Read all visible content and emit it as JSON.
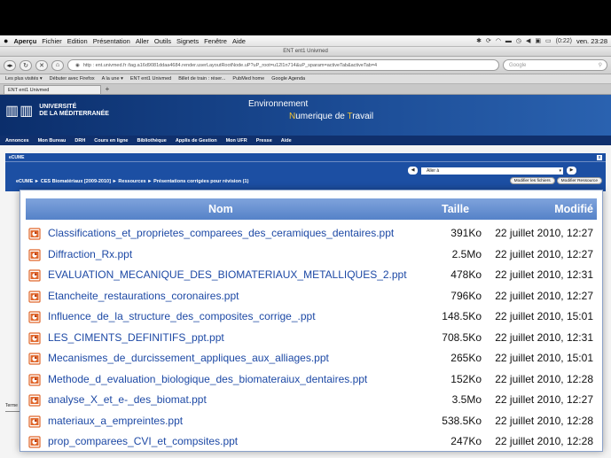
{
  "menubar": {
    "app": "Aperçu",
    "items": [
      "Fichier",
      "Edition",
      "Présentation",
      "Aller",
      "Outils",
      "Signets",
      "Fenêtre",
      "Aide"
    ],
    "battery": "(0:22)",
    "clock": "ven. 23:28"
  },
  "browser": {
    "window_title": "ENT ent1 Univmed",
    "url": "http : ent.univmed.fr /tag.a16d9081ddaa4684.render.userLayoutRootNode.uP?uP_root=u12l1n714&uP_sparam=activeTab&activeTab=4",
    "search_placeholder": "Google",
    "bookmarks": [
      "Les plus visités ▾",
      "Débuter avec Firefox",
      "A la une ▾",
      "ENT ent1 Univmed",
      "Billet de train : réser...",
      "PubMed home",
      "Google Agenda"
    ],
    "tab_label": "ENT ent1 Univmed",
    "newtab_label": "+"
  },
  "site": {
    "university_line1": "UNIVERSITÉ",
    "university_line2": "DE LA MÉDITERRANÉE",
    "env_line1_prefix": "Environnement",
    "env_line2_a": "N",
    "env_line2_b": "umerique de ",
    "env_line2_c": "T",
    "env_line2_d": "ravail",
    "nav": [
      "Annonces",
      "Mon Bureau",
      "DRH",
      "Cours en ligne",
      "Bibliothèque",
      "Applis de Gestion",
      "Mon UFR",
      "Presse",
      "Aide"
    ]
  },
  "ecume": {
    "title": "eCUME",
    "close": "x",
    "goto_label": "Aller à",
    "breadcrumb": "eCUME  ►  CES Biomatériaux [2009-2010]  ►  Ressources  ►  Présentations corrigées pour révision (1)",
    "btn_files": "Modifier les fichiers",
    "btn_resource": "Modifier Ressource",
    "footer_link": "Terme"
  },
  "files": {
    "col_name": "Nom",
    "col_size": "Taille",
    "col_modified": "Modifié",
    "rows": [
      {
        "name": "Classifications_et_proprietes_comparees_des_ceramiques_dentaires.ppt",
        "size": "391Ko",
        "date": "22 juillet 2010, 12:27"
      },
      {
        "name": "Diffraction_Rx.ppt",
        "size": "2.5Mo",
        "date": "22 juillet 2010, 12:27"
      },
      {
        "name": "EVALUATION_MECANIQUE_DES_BIOMATERIAUX_METALLIQUES_2.ppt",
        "size": "478Ko",
        "date": "22 juillet 2010, 12:31"
      },
      {
        "name": "Etancheite_restaurations_coronaires.ppt",
        "size": "796Ko",
        "date": "22 juillet 2010, 12:27"
      },
      {
        "name": "Influence_de_la_structure_des_composites_corrige_.ppt",
        "size": "148.5Ko",
        "date": "22 juillet 2010, 15:01"
      },
      {
        "name": "LES_CIMENTS_DEFINITIFS_ppt.ppt",
        "size": "708.5Ko",
        "date": "22 juillet 2010, 12:31"
      },
      {
        "name": "Mecanismes_de_durcissement_appliques_aux_alliages.ppt",
        "size": "265Ko",
        "date": "22 juillet 2010, 15:01"
      },
      {
        "name": "Methode_d_evaluation_biologique_des_biomateraiux_dentaires.ppt",
        "size": "152Ko",
        "date": "22 juillet 2010, 12:28"
      },
      {
        "name": "analyse_X_et_e-_des_biomat.ppt",
        "size": "3.5Mo",
        "date": "22 juillet 2010, 12:27"
      },
      {
        "name": "materiaux_a_empreintes.ppt",
        "size": "538.5Ko",
        "date": "22 juillet 2010, 12:28"
      },
      {
        "name": "prop_comparees_CVI_et_compsites.ppt",
        "size": "247Ko",
        "date": "22 juillet 2010, 12:28"
      }
    ]
  },
  "colors": {
    "header_blue": "#5582c8",
    "link_blue": "#1d49a5",
    "ppt_orange": "#e0662a"
  }
}
